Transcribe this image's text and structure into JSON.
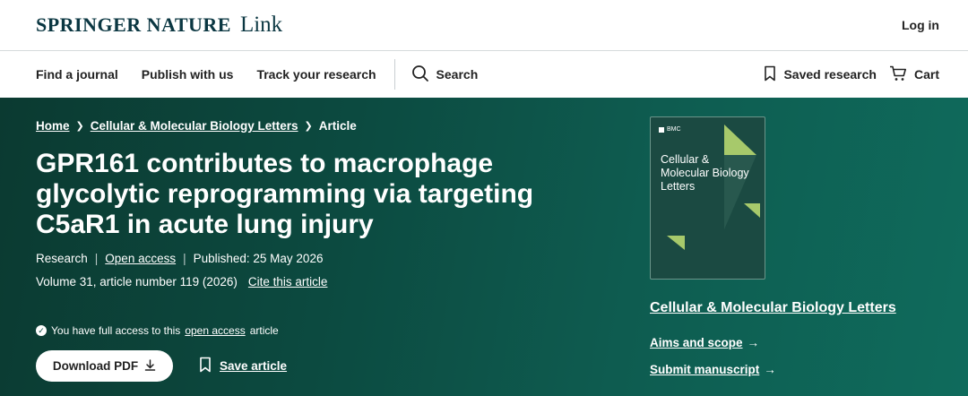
{
  "brand": {
    "name": "SPRINGER NATURE",
    "product": "Link"
  },
  "header": {
    "login_label": "Log in"
  },
  "nav": {
    "items": [
      "Find a journal",
      "Publish with us",
      "Track your research"
    ],
    "search_label": "Search",
    "saved_label": "Saved research",
    "cart_label": "Cart"
  },
  "breadcrumb": {
    "home": "Home",
    "journal": "Cellular & Molecular Biology Letters",
    "current": "Article"
  },
  "article": {
    "title": "GPR161 contributes to macrophage glycolytic reprogramming via targeting C5aR1 in acute lung injury",
    "type": "Research",
    "access": "Open access",
    "published": "Published: 25 May 2026",
    "volume": "Volume 31, article number 119 (2026)",
    "cite": "Cite this article",
    "access_note_prefix": "You have full access to this",
    "access_note_link": "open access",
    "access_note_suffix": "article",
    "download_label": "Download PDF",
    "save_label": "Save article"
  },
  "journal": {
    "cover_publisher": "BMC",
    "cover_title": "Cellular & Molecular Biology Letters",
    "name": "Cellular & Molecular Biology Letters",
    "aims_label": "Aims and scope",
    "submit_label": "Submit manuscript"
  },
  "colors": {
    "hero_dark": "#0b3a31",
    "hero_light": "#0f6b5c",
    "brand": "#0b3742",
    "cover_accent": "#a7c96b"
  }
}
